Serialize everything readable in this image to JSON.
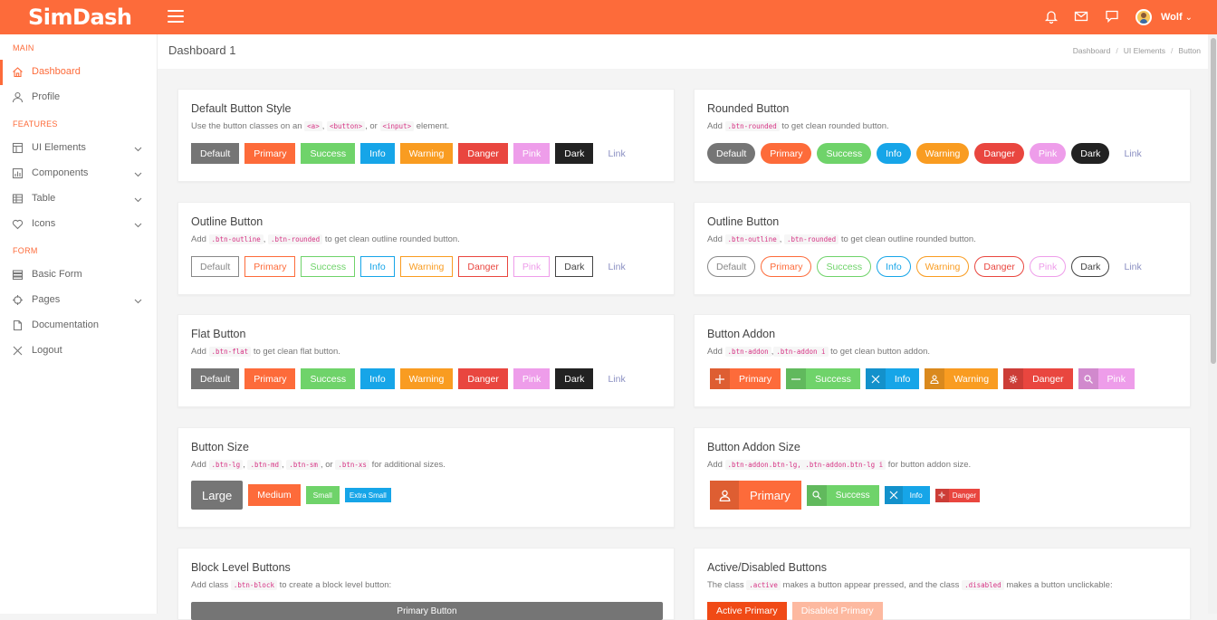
{
  "app": {
    "brand": "SimDash",
    "user_name": "Wolf"
  },
  "header": {
    "icons": [
      "bell-icon",
      "mail-icon",
      "chat-icon"
    ]
  },
  "sidebar": {
    "sections": [
      "MAIN",
      "FEATURES",
      "FORM"
    ],
    "items": [
      {
        "label": "Dashboard",
        "icon": "home-icon",
        "active": true
      },
      {
        "label": "Profile",
        "icon": "user-icon"
      },
      {
        "label": "UI Elements",
        "icon": "layout-icon",
        "expandable": true
      },
      {
        "label": "Components",
        "icon": "chart-icon",
        "expandable": true
      },
      {
        "label": "Table",
        "icon": "table-icon",
        "expandable": true
      },
      {
        "label": "Icons",
        "icon": "heart-icon",
        "expandable": true
      },
      {
        "label": "Basic Form",
        "icon": "list-icon"
      },
      {
        "label": "Pages",
        "icon": "target-icon",
        "expandable": true
      },
      {
        "label": "Documentation",
        "icon": "file-icon"
      },
      {
        "label": "Logout",
        "icon": "close-icon"
      }
    ]
  },
  "page": {
    "title": "Dashboard 1",
    "breadcrumb": [
      "Dashboard",
      "UI Elements",
      "Button"
    ]
  },
  "colors": {
    "primary": "#fd6b3a",
    "success": "#6fd36a",
    "info": "#16a5e8",
    "warning": "#f99c21",
    "danger": "#e9463f",
    "pink": "#ee9dea",
    "dark": "#222222",
    "default": "#757575"
  },
  "buttons": {
    "default": "Default",
    "primary": "Primary",
    "success": "Success",
    "info": "Info",
    "warning": "Warning",
    "danger": "Danger",
    "pink": "Pink",
    "dark": "Dark",
    "link": "Link"
  },
  "cards": {
    "default": {
      "title": "Default Button Style",
      "d1": "Use the button classes on an",
      "c1": "<a>",
      "d2": ",",
      "c2": "<button>",
      "d3": ", or",
      "c3": "<input>",
      "d4": "element."
    },
    "rounded": {
      "title": "Rounded Button",
      "d1": "Add",
      "c1": ".btn-rounded",
      "d2": "to get clean rounded button."
    },
    "outline1": {
      "title": "Outline Button",
      "d1": "Add",
      "c1": ".btn-outline",
      "d2": ",",
      "c2": ".btn-rounded",
      "d3": "to get clean outline rounded button."
    },
    "outline2": {
      "title": "Outline Button",
      "d1": "Add",
      "c1": ".btn-outline",
      "d2": ",",
      "c2": ".btn-rounded",
      "d3": "to get clean outline rounded button."
    },
    "flat": {
      "title": "Flat Button",
      "d1": "Add",
      "c1": ".btn-flat",
      "d2": "to get clean flat button."
    },
    "addon": {
      "title": "Button Addon",
      "d1": "Add",
      "c1": ".btn-addon",
      "d2": ",",
      "c2": ".btn-addon i",
      "d3": "to get clean button addon."
    },
    "size": {
      "title": "Button Size",
      "d1": "Add",
      "c1": ".btn-lg",
      "d2": ",",
      "c2": ".btn-md",
      "d3": ",",
      "c3": ".btn-sm",
      "d4": ", or",
      "c4": ".btn-xs",
      "d5": "for additional sizes.",
      "large": "Large",
      "medium": "Medium",
      "small": "Small",
      "xsmall": "Extra Small"
    },
    "addonsize": {
      "title": "Button Addon Size",
      "d1": "Add",
      "c1": ".btn-addon.btn-lg, .btn-addon.btn-lg i",
      "d2": "for button addon size."
    },
    "block": {
      "title": "Block Level Buttons",
      "d1": "Add class",
      "c1": ".btn-block",
      "d2": "to create a block level button:",
      "btn": "Primary Button"
    },
    "active": {
      "title": "Active/Disabled Buttons",
      "d1": "The class",
      "c1": ".active",
      "d2": "makes a button appear pressed, and the class",
      "c2": ".disabled",
      "d3": "makes a button unclickable:",
      "active_btn": "Active Primary",
      "disabled_btn": "Disabled Primary"
    }
  }
}
